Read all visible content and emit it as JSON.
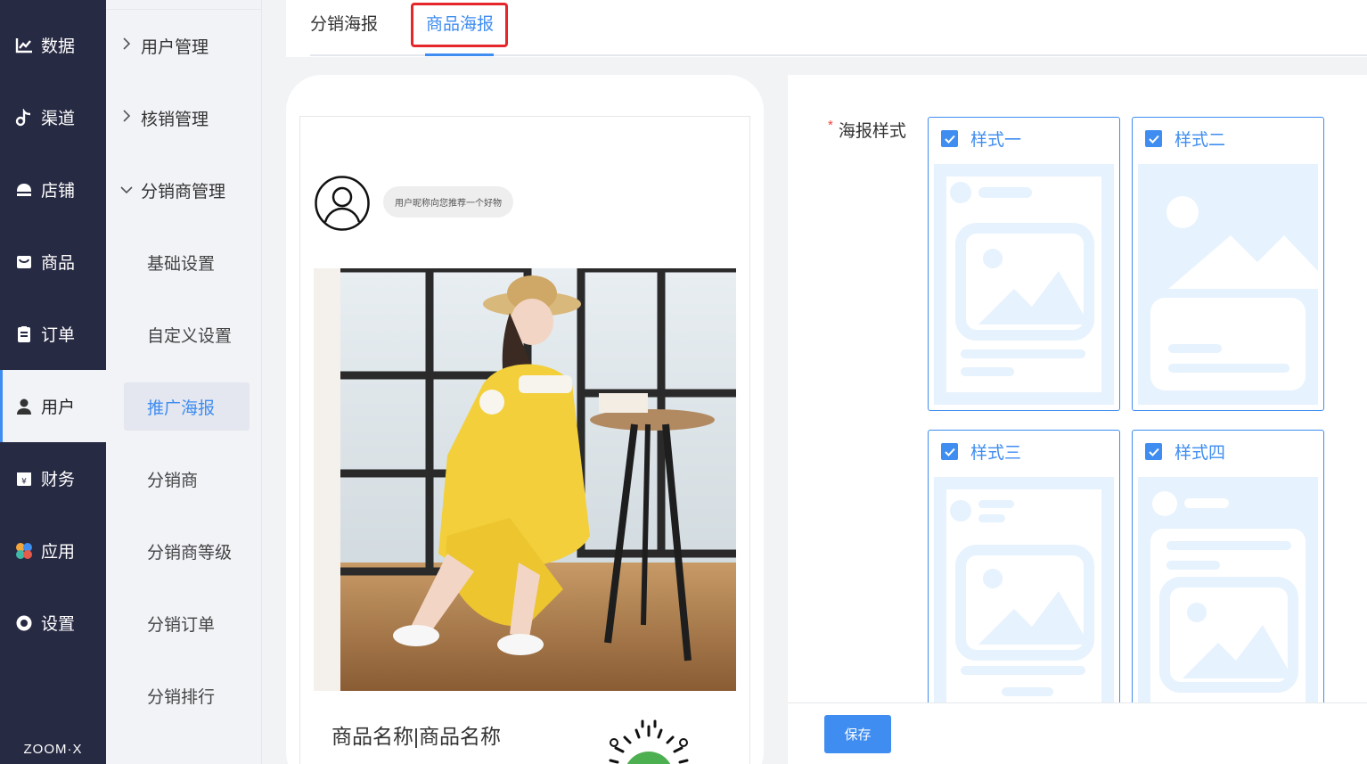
{
  "nav": {
    "items": [
      {
        "label": "数据",
        "icon": "chart-icon"
      },
      {
        "label": "渠道",
        "icon": "channel-icon"
      },
      {
        "label": "店铺",
        "icon": "store-icon"
      },
      {
        "label": "商品",
        "icon": "goods-icon"
      },
      {
        "label": "订单",
        "icon": "order-icon"
      },
      {
        "label": "用户",
        "icon": "user-icon",
        "active": true
      },
      {
        "label": "财务",
        "icon": "finance-icon"
      },
      {
        "label": "应用",
        "icon": "apps-icon"
      },
      {
        "label": "设置",
        "icon": "settings-icon"
      }
    ],
    "brand": "ZOOM·X"
  },
  "submenu": {
    "items": [
      {
        "label": "用户管理",
        "type": "parent",
        "expanded": false
      },
      {
        "label": "核销管理",
        "type": "parent",
        "expanded": false
      },
      {
        "label": "分销商管理",
        "type": "parent",
        "expanded": true
      },
      {
        "label": "基础设置",
        "type": "child"
      },
      {
        "label": "自定义设置",
        "type": "child"
      },
      {
        "label": "推广海报",
        "type": "child",
        "active": true
      },
      {
        "label": "分销商",
        "type": "child"
      },
      {
        "label": "分销商等级",
        "type": "child"
      },
      {
        "label": "分销订单",
        "type": "child"
      },
      {
        "label": "分销排行",
        "type": "child"
      }
    ]
  },
  "tabs": [
    {
      "label": "分销海报",
      "active": false
    },
    {
      "label": "商品海报",
      "active": true
    }
  ],
  "preview": {
    "bubble_text": "用户昵称向您推荐一个好物",
    "product_name": "商品名称|商品名称"
  },
  "form": {
    "label": "海报样式",
    "required_mark": "*",
    "styles": [
      {
        "label": "样式一",
        "checked": true
      },
      {
        "label": "样式二",
        "checked": true
      },
      {
        "label": "样式三",
        "checked": true
      },
      {
        "label": "样式四",
        "checked": true
      }
    ],
    "save_label": "保存"
  },
  "colors": {
    "nav_bg": "#272a43",
    "accent": "#3f8df0",
    "highlight": "#e5262b",
    "placeholder": "#e6f2fd"
  }
}
